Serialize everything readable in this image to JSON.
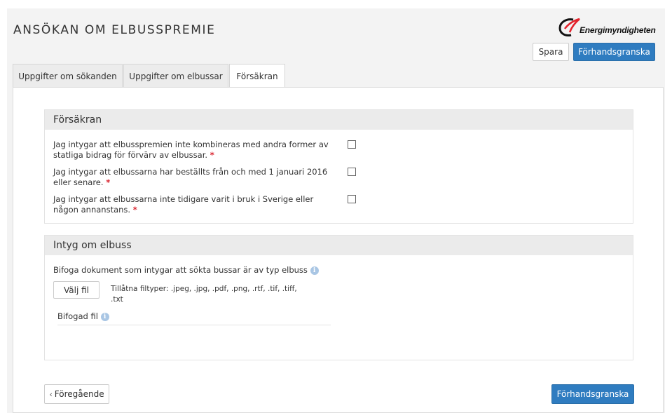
{
  "header": {
    "title": "ANSÖKAN OM ELBUSSPREMIE",
    "logo_text": "Energimyndigheten",
    "save_label": "Spara",
    "preview_label": "Förhandsgranska"
  },
  "tabs": [
    {
      "label": "Uppgifter om sökanden",
      "active": false
    },
    {
      "label": "Uppgifter om elbussar",
      "active": false
    },
    {
      "label": "Försäkran",
      "active": true
    }
  ],
  "declaration": {
    "heading": "Försäkran",
    "items": [
      {
        "line1": "Jag intygar att elbusspremien inte kombineras med andra former av",
        "line2": "statliga bidrag för förvärv av elbussar.",
        "required": "*",
        "checked": false
      },
      {
        "line1": "Jag intygar att elbussarna har beställts från och med 1 januari 2016",
        "line2": "eller senare.",
        "required": "*",
        "checked": false
      },
      {
        "line1": "Jag intygar att elbussarna inte tidigare varit i bruk i Sverige eller",
        "line2": "någon annanstans.",
        "required": "*",
        "checked": false
      }
    ]
  },
  "certificate": {
    "heading": "Intyg om elbuss",
    "attach_label": "Bifoga dokument som intygar att sökta bussar är av typ elbuss",
    "choose_file_label": "Välj fil",
    "file_types_line1": "Tillåtna filtyper: .jpeg, .jpg, .pdf, .png, .rtf, .tif, .tiff,",
    "file_types_line2": ".txt",
    "attached_label": "Bifogad fil",
    "info_icon_glyph": "i"
  },
  "footer": {
    "previous_label": "Föregående",
    "previous_chevron": "‹",
    "preview_label": "Förhandsgranska"
  },
  "colors": {
    "primary": "#2f7cc0",
    "required": "#d9232e",
    "logo_red": "#e3222b"
  }
}
